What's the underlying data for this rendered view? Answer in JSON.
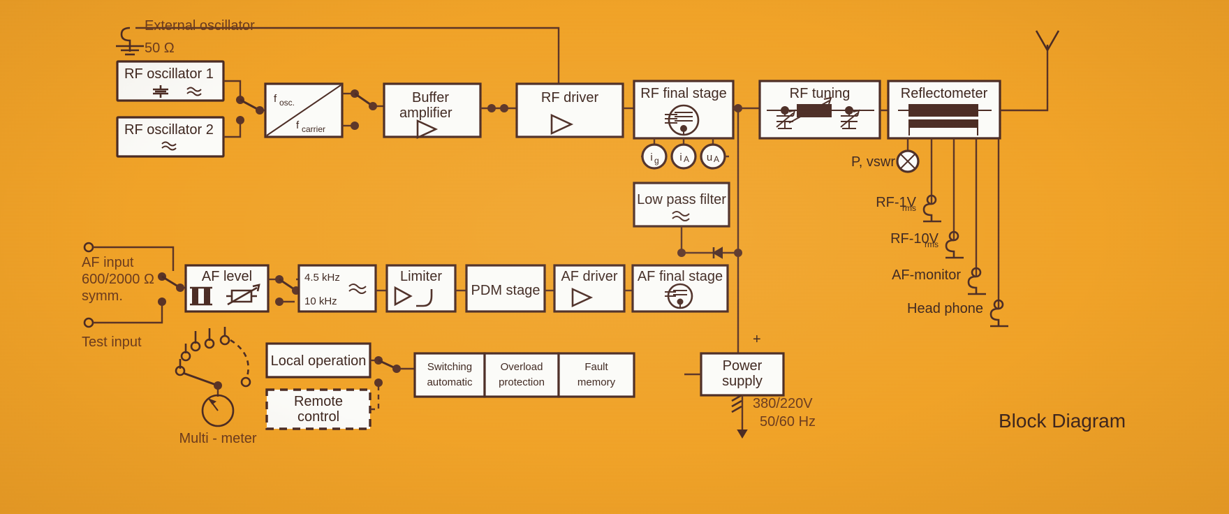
{
  "meta": {
    "title": "Block Diagram",
    "background_color": "#F2A326",
    "line_color": "#4A2A22",
    "box_fill": "#FDFDFA"
  },
  "blocks": {
    "rf_osc_1": "RF oscillator 1",
    "rf_osc_2": "RF oscillator 2",
    "mixer_top": "f",
    "mixer_top_sub": "osc.",
    "mixer_bot": "f",
    "mixer_bot_sub": "carrier",
    "buffer_line1": "Buffer",
    "buffer_line2": "amplifier",
    "rf_driver": "RF driver",
    "rf_final_stage": "RF final stage",
    "low_pass_filter": "Low pass filter",
    "rf_tuning": "RF tuning",
    "reflectometer": "Reflectometer",
    "af_level": "AF level",
    "filter_45": "4.5 kHz",
    "filter_10": "10 kHz",
    "limiter": "Limiter",
    "pdm_stage": "PDM stage",
    "af_driver": "AF driver",
    "af_final_stage": "AF final stage",
    "local_operation": "Local operation",
    "remote_line1": "Remote",
    "remote_line2": "control",
    "switching_line1": "Switching",
    "switching_line2": "automatic",
    "overload_line1": "Overload",
    "overload_line2": "protection",
    "fault_line1": "Fault",
    "fault_line2": "memory",
    "power_line1": "Power",
    "power_line2": "supply"
  },
  "labels": {
    "external_oscillator": "External oscillator",
    "impedance_50": "50 Ω",
    "af_input_line1": "AF input",
    "af_input_line2": "600/2000 Ω",
    "af_input_line3": "symm.",
    "test_input": "Test input",
    "multi_meter": "Multi - meter",
    "mains_line1": "380/220V",
    "mains_line2": "50/60 Hz",
    "plus_sign": "+"
  },
  "meters": {
    "i_g": "i",
    "i_g_sub": "g",
    "i_a": "i",
    "i_a_sub": "A",
    "u_a": "u",
    "u_a_sub": "A",
    "p_vswr": "P, vswr"
  },
  "outputs": [
    {
      "label": "RF-1V",
      "sub": "rms"
    },
    {
      "label": "RF-10V",
      "sub": "rms"
    },
    {
      "label": "AF-monitor",
      "sub": ""
    },
    {
      "label": "Head phone",
      "sub": ""
    }
  ],
  "icons": {
    "antenna": "antenna-icon",
    "ground": "ground-icon",
    "amplifier": "triangle-amplifier-icon",
    "tube": "vacuum-tube-icon",
    "wave": "sine-wave-icon",
    "crystal": "crystal-icon",
    "attenuator": "variable-attenuator-icon",
    "meter": "analog-meter-icon",
    "diode": "diode-icon",
    "terminal": "coax-terminal-icon",
    "cross_meter": "cross-meter-icon"
  }
}
